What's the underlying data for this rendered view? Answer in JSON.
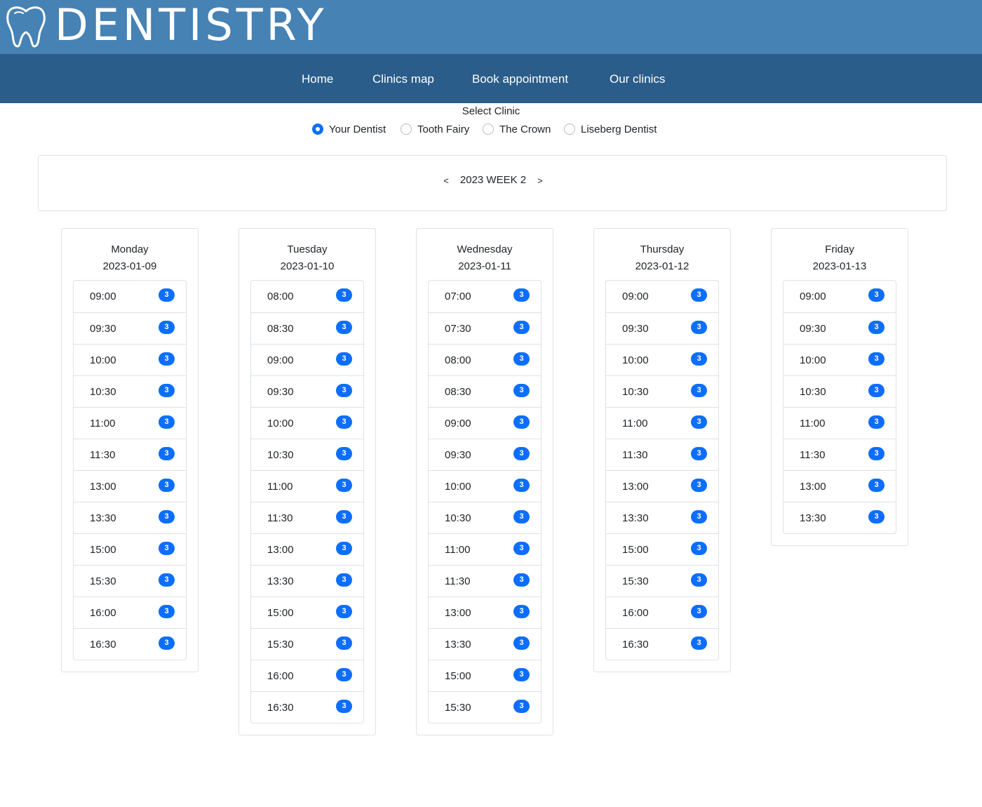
{
  "brand": {
    "title": "DENTISTRY",
    "icon": "tooth-icon"
  },
  "nav": {
    "items": [
      {
        "label": "Home"
      },
      {
        "label": "Clinics map"
      },
      {
        "label": "Book appointment"
      },
      {
        "label": "Our clinics"
      }
    ]
  },
  "clinic_select": {
    "title": "Select Clinic",
    "selected": "Your Dentist",
    "options": [
      {
        "label": "Your Dentist",
        "checked": true
      },
      {
        "label": "Tooth Fairy",
        "checked": false
      },
      {
        "label": "The Crown",
        "checked": false
      },
      {
        "label": "Liseberg Dentist",
        "checked": false
      }
    ]
  },
  "week": {
    "label": "2023 WEEK 2",
    "prev": "<",
    "next": ">"
  },
  "days": [
    {
      "name": "Monday",
      "date": "2023-01-09",
      "slots": [
        {
          "time": "09:00",
          "count": "3"
        },
        {
          "time": "09:30",
          "count": "3"
        },
        {
          "time": "10:00",
          "count": "3"
        },
        {
          "time": "10:30",
          "count": "3"
        },
        {
          "time": "11:00",
          "count": "3"
        },
        {
          "time": "11:30",
          "count": "3"
        },
        {
          "time": "13:00",
          "count": "3"
        },
        {
          "time": "13:30",
          "count": "3"
        },
        {
          "time": "15:00",
          "count": "3"
        },
        {
          "time": "15:30",
          "count": "3"
        },
        {
          "time": "16:00",
          "count": "3"
        },
        {
          "time": "16:30",
          "count": "3"
        }
      ]
    },
    {
      "name": "Tuesday",
      "date": "2023-01-10",
      "slots": [
        {
          "time": "08:00",
          "count": "3"
        },
        {
          "time": "08:30",
          "count": "3"
        },
        {
          "time": "09:00",
          "count": "3"
        },
        {
          "time": "09:30",
          "count": "3"
        },
        {
          "time": "10:00",
          "count": "3"
        },
        {
          "time": "10:30",
          "count": "3"
        },
        {
          "time": "11:00",
          "count": "3"
        },
        {
          "time": "11:30",
          "count": "3"
        },
        {
          "time": "13:00",
          "count": "3"
        },
        {
          "time": "13:30",
          "count": "3"
        },
        {
          "time": "15:00",
          "count": "3"
        },
        {
          "time": "15:30",
          "count": "3"
        },
        {
          "time": "16:00",
          "count": "3"
        },
        {
          "time": "16:30",
          "count": "3"
        }
      ]
    },
    {
      "name": "Wednesday",
      "date": "2023-01-11",
      "slots": [
        {
          "time": "07:00",
          "count": "3"
        },
        {
          "time": "07:30",
          "count": "3"
        },
        {
          "time": "08:00",
          "count": "3"
        },
        {
          "time": "08:30",
          "count": "3"
        },
        {
          "time": "09:00",
          "count": "3"
        },
        {
          "time": "09:30",
          "count": "3"
        },
        {
          "time": "10:00",
          "count": "3"
        },
        {
          "time": "10:30",
          "count": "3"
        },
        {
          "time": "11:00",
          "count": "3"
        },
        {
          "time": "11:30",
          "count": "3"
        },
        {
          "time": "13:00",
          "count": "3"
        },
        {
          "time": "13:30",
          "count": "3"
        },
        {
          "time": "15:00",
          "count": "3"
        },
        {
          "time": "15:30",
          "count": "3"
        }
      ]
    },
    {
      "name": "Thursday",
      "date": "2023-01-12",
      "slots": [
        {
          "time": "09:00",
          "count": "3"
        },
        {
          "time": "09:30",
          "count": "3"
        },
        {
          "time": "10:00",
          "count": "3"
        },
        {
          "time": "10:30",
          "count": "3"
        },
        {
          "time": "11:00",
          "count": "3"
        },
        {
          "time": "11:30",
          "count": "3"
        },
        {
          "time": "13:00",
          "count": "3"
        },
        {
          "time": "13:30",
          "count": "3"
        },
        {
          "time": "15:00",
          "count": "3"
        },
        {
          "time": "15:30",
          "count": "3"
        },
        {
          "time": "16:00",
          "count": "3"
        },
        {
          "time": "16:30",
          "count": "3"
        }
      ]
    },
    {
      "name": "Friday",
      "date": "2023-01-13",
      "slots": [
        {
          "time": "09:00",
          "count": "3"
        },
        {
          "time": "09:30",
          "count": "3"
        },
        {
          "time": "10:00",
          "count": "3"
        },
        {
          "time": "10:30",
          "count": "3"
        },
        {
          "time": "11:00",
          "count": "3"
        },
        {
          "time": "11:30",
          "count": "3"
        },
        {
          "time": "13:00",
          "count": "3"
        },
        {
          "time": "13:30",
          "count": "3"
        }
      ]
    }
  ],
  "colors": {
    "brand_bar": "#4682b4",
    "nav_bar": "#2a5d8a",
    "accent": "#0d6efd",
    "border": "#dee2e6"
  }
}
